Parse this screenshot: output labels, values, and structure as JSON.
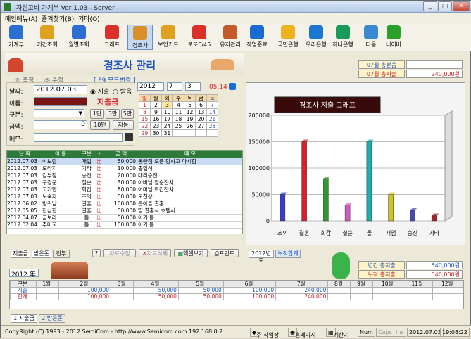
{
  "window": {
    "title": "자린고비 가계부 Ver 1.03 - Server"
  },
  "menu": [
    "메인메뉴(A)",
    "즐겨찾기(B)",
    "기타(O)"
  ],
  "toolbar": [
    {
      "label": "가계부",
      "icon": "ledger-icon"
    },
    {
      "label": "기간조회",
      "icon": "period-search-icon"
    },
    {
      "label": "월별조회",
      "icon": "monthly-search-icon"
    },
    {
      "label": "그래프",
      "icon": "graph-icon"
    },
    {
      "label": "경조사",
      "icon": "family-event-icon"
    },
    {
      "label": "보안카드",
      "icon": "security-card-icon"
    },
    {
      "label": "로또6/45",
      "icon": "lotto-icon"
    },
    {
      "label": "유저관리",
      "icon": "user-manage-icon"
    },
    {
      "label": "작업종료",
      "icon": "exit-icon"
    },
    {
      "label": "국민은행",
      "icon": "kb-bank-icon"
    },
    {
      "label": "우리은행",
      "icon": "woori-bank-icon"
    },
    {
      "label": "하나은행",
      "icon": "hana-bank-icon"
    },
    {
      "label": "다음",
      "icon": "daum-icon"
    },
    {
      "label": "네이버",
      "icon": "naver-icon"
    }
  ],
  "header": {
    "title": "경조사 관리",
    "mode_button": "[ F9 모드변경 ]",
    "radio_receive": "증정",
    "radio_give": "수정"
  },
  "summary_top": {
    "receive_label": "07월 총받음",
    "receive_value": "",
    "spend_label": "07월 총지출",
    "spend_value": "240,000원"
  },
  "form": {
    "date_label": "날짜:",
    "date_value": "2012.07.03",
    "name_label": "이름:",
    "category_label": "구분:",
    "amount_label": "금액:",
    "amount_value": "0",
    "memo_label": "메모:",
    "radio_spend": "지출",
    "radio_get": "받음",
    "big_label": "지출금",
    "btn_1": "1만",
    "btn_3": "3만",
    "btn_5": "5만",
    "btn_10": "10만",
    "btn_auto": "자동"
  },
  "calendar": {
    "year": "2012",
    "month": "7",
    "day": "3",
    "today": "05.14",
    "weekdays": [
      "일",
      "월",
      "화",
      "수",
      "목",
      "금",
      "토"
    ],
    "rows": [
      [
        "1",
        "2",
        "3",
        "4",
        "5",
        "6",
        "7"
      ],
      [
        "8",
        "9",
        "10",
        "11",
        "12",
        "13",
        "14"
      ],
      [
        "15",
        "16",
        "17",
        "18",
        "19",
        "20",
        "21"
      ],
      [
        "22",
        "23",
        "24",
        "25",
        "26",
        "27",
        "28"
      ],
      [
        "29",
        "30",
        "31",
        "",
        "",
        "",
        ""
      ]
    ]
  },
  "list": {
    "headers": [
      "날 짜",
      "이 름",
      "구분",
      "±",
      "금 액",
      "메 모"
    ],
    "rows": [
      [
        "2012.07.03",
        "이보람",
        "개업",
        "出",
        "50,000",
        "동탄점 오픈 망하고 다시함"
      ],
      [
        "2012.07.03",
        "도라지",
        "기타",
        "出",
        "10,000",
        "졸업식"
      ],
      [
        "2012.07.03",
        "김부장",
        "승진",
        "出",
        "20,000",
        "대리승진"
      ],
      [
        "2012.07.03",
        "구경꾼",
        "칠순",
        "出",
        "30,000",
        "아버님 칠순잔치"
      ],
      [
        "2012.07.03",
        "고가한",
        "회갑",
        "出",
        "80,000",
        "어머님 회갑잔치"
      ],
      [
        "2012.07.03",
        "노숙자",
        "조의",
        "出",
        "50,000",
        "모친상"
      ],
      [
        "2012.06.02",
        "방귀남",
        "결혼",
        "出",
        "100,000",
        "큰아들 결혼"
      ],
      [
        "2012.05.05",
        "한심한",
        "결혼",
        "出",
        "50,000",
        "딸 결혼식 호텔서"
      ],
      [
        "2012.04.07",
        "금보라",
        "돌",
        "出",
        "50,000",
        "아기 돌"
      ],
      [
        "2012.02.04",
        "주머꼬",
        "돌",
        "出",
        "100,000",
        "아기 돌"
      ]
    ]
  },
  "chart_data": {
    "type": "bar",
    "title": "경조사 지출 그래프",
    "categories": [
      "조의",
      "결혼",
      "회갑",
      "칠순",
      "돌",
      "개업",
      "승진",
      "기타"
    ],
    "values": [
      50000,
      150000,
      80000,
      30000,
      150000,
      50000,
      20000,
      10000
    ],
    "colors": [
      "#3a3acb",
      "#d8202a",
      "#2e9a2e",
      "#d05cc0",
      "#1ab0b0",
      "#d2c21c",
      "#4a4aa8",
      "#a02222"
    ],
    "ylim": [
      0,
      200000
    ],
    "yticks": [
      "200000",
      "150000",
      "100000",
      "50000",
      "0"
    ]
  },
  "bottom_tabs": {
    "receive": "지출금",
    "give": "받은돈",
    "all": "전부"
  },
  "actions": {
    "edit": "자료수정",
    "delete": "자료삭제",
    "excel": "엑셀보기",
    "print": "프린트",
    "year_tab": "2012년도",
    "accum_tab": "누적합계"
  },
  "summary_bottom": {
    "year_label": "년간 총지출",
    "year_value": "540,000원",
    "accum_label": "누적 총지출",
    "accum_value": "540,000원"
  },
  "year_select": "2012 年",
  "monthly": {
    "headers": [
      "구분",
      "1월",
      "2월",
      "3월",
      "4월",
      "5월",
      "6월",
      "7월",
      "8월",
      "9월",
      "10월",
      "11월",
      "12월"
    ],
    "rows": [
      [
        "지출",
        "",
        "100,000",
        "",
        "50,000",
        "50,000",
        "100,000",
        "240,000",
        "",
        "",
        "",
        "",
        ""
      ],
      [
        "합계",
        "",
        "100,000",
        "",
        "50,000",
        "50,000",
        "100,000",
        "240,000",
        "",
        "",
        "",
        "",
        ""
      ]
    ]
  },
  "sheet_tabs": [
    "1.지출금",
    "2.받은돈"
  ],
  "status": {
    "copyright": "CopyRight (C) 1993 - 2012 SemiCom - http://www.Semicom.com  192.168.0.2",
    "workplace": "주 작업장",
    "homepage": "홈페이지",
    "calc": "계산기",
    "num": "Num",
    "caps": "Caps",
    "ins": "Ins",
    "date": "2012.07.03",
    "time": "19:08:22"
  }
}
